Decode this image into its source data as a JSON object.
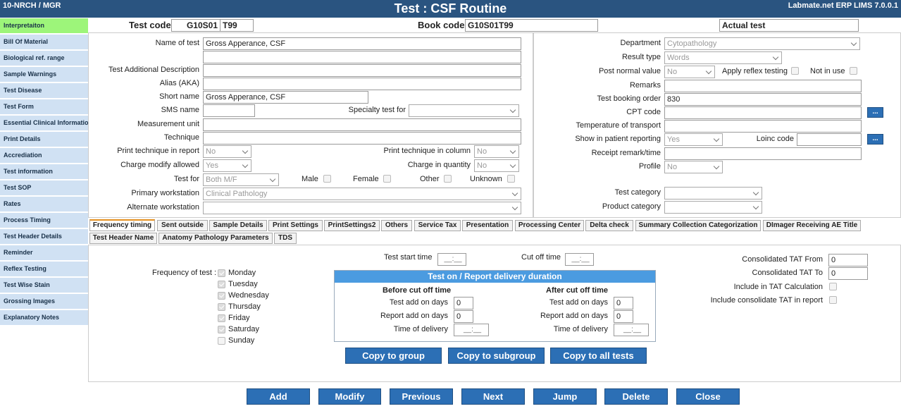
{
  "header": {
    "left": "10-NRCH / MGR",
    "title": "Test : CSF Routine",
    "right": "Labmate.net ERP LIMS 7.0.0.1"
  },
  "sidebar": [
    "Interpretaiton",
    "Bill Of Material",
    "Biological ref. range",
    "Sample Warnings",
    "Test Disease",
    "Test Form",
    "Essential Clinical Information",
    "Print Details",
    "Accrediation",
    "Test information",
    "Test SOP",
    "Rates",
    "Process Timing",
    "Test Header Details",
    "Reminder",
    "Reflex Testing",
    "Test Wise Stain",
    "Grossing Images",
    "Explanatory Notes"
  ],
  "topbar": {
    "test_code_label": "Test code",
    "test_code": "G10S01",
    "test_code2": "T99",
    "book_code_label": "Book code",
    "book_code": "G10S01T99",
    "actual_test": "Actual test"
  },
  "left": {
    "name_of_test_label": "Name of test",
    "name_of_test": "Gross Apperance, CSF",
    "additional_desc_label": "Test Additional Description",
    "alias_label": "Alias (AKA)",
    "short_name_label": "Short name",
    "short_name": "Gross Apperance, CSF",
    "sms_name_label": "SMS name",
    "specialty_label": "Specialty test for",
    "measurement_label": "Measurement unit",
    "technique_label": "Technique",
    "print_tech_report_label": "Print technique in report",
    "print_tech_report": "No",
    "print_tech_column_label": "Print technique in column",
    "print_tech_column": "No",
    "charge_modify_label": "Charge modify allowed",
    "charge_modify": "Yes",
    "charge_qty_label": "Charge in quantity",
    "charge_qty": "No",
    "test_for_label": "Test for",
    "test_for": "Both M/F",
    "male": "Male",
    "female": "Female",
    "other": "Other",
    "unknown": "Unknown",
    "primary_ws_label": "Primary workstation",
    "primary_ws": "Clinical Pathology",
    "alternate_ws_label": "Alternate workstation"
  },
  "right": {
    "department_label": "Department",
    "department": "Cytopathology",
    "result_type_label": "Result type",
    "result_type": "Words",
    "post_normal_label": "Post normal value",
    "post_normal": "No",
    "apply_reflex": "Apply reflex testing",
    "not_in_use": "Not in use",
    "remarks_label": "Remarks",
    "booking_order_label": "Test booking order",
    "booking_order": "830",
    "cpt_label": "CPT code",
    "dots": "...",
    "temperature_label": "Temperature of transport",
    "show_patient_label": "Show in patient reporting",
    "show_patient": "Yes",
    "loinc_label": "Loinc code",
    "receipt_label": "Receipt remark/time",
    "profile_label": "Profile",
    "profile": "No",
    "test_category_label": "Test category",
    "product_category_label": "Product category"
  },
  "tabs_row1": [
    "Frequency timing",
    "Sent outside",
    "Sample Details",
    "Print Settings",
    "PrintSettings2",
    "Others",
    "Service Tax",
    "Presentation",
    "Processing Center",
    "Delta check",
    "Summary Collection Categorization",
    "DImager Receiving AE Title"
  ],
  "tabs_row2": [
    "Test Header Name",
    "Anatomy Pathology Parameters",
    "TDS"
  ],
  "freq": {
    "freq_label": "Frequency of test :",
    "days": [
      "Monday",
      "Tuesday",
      "Wednesday",
      "Thursday",
      "Friday",
      "Saturday",
      "Sunday"
    ],
    "start_time_label": "Test start time",
    "start_time": "__:__",
    "cutoff_label": "Cut off time",
    "cutoff": "__:__",
    "box_title": "Test on / Report delivery duration",
    "before": "Before cut off time",
    "after": "After cut off time",
    "test_add": "Test add on days",
    "report_add": "Report add on days",
    "time_delivery": "Time of delivery",
    "zero": "0",
    "tat_from_label": "Consolidated TAT From",
    "tat_from": "0",
    "tat_to_label": "Consolidated TAT To",
    "tat_to": "0",
    "include_tat": "Include in TAT Calculation",
    "include_consolidate": "Include consolidate TAT in report"
  },
  "copy_buttons": [
    "Copy to group",
    "Copy to subgroup",
    "Copy to all tests"
  ],
  "footer": [
    "Add",
    "Modify",
    "Previous",
    "Next",
    "Jump",
    "Delete",
    "Close"
  ]
}
